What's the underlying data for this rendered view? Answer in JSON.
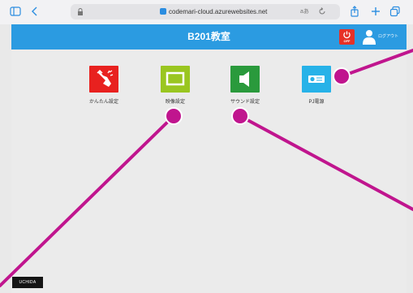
{
  "browser": {
    "url": "codemari-cloud.azurewebsites.net",
    "text_size_label": "aあ"
  },
  "header": {
    "title": "B201教室",
    "power_off_label": "OFF",
    "logout_label": "ログアウト"
  },
  "tiles": [
    {
      "label": "かんたん設定",
      "color": "#e8211f",
      "icon": "hand-tap-icon"
    },
    {
      "label": "映像設定",
      "color": "#9ac620",
      "icon": "screen-icon"
    },
    {
      "label": "サウンド設定",
      "color": "#2a9a3c",
      "icon": "speaker-icon"
    },
    {
      "label": "PJ電源",
      "color": "#27b2e8",
      "icon": "projector-icon"
    }
  ],
  "brand": {
    "logo_text": "UCHIDA"
  },
  "colors": {
    "header_bg": "#2b9be1",
    "annotation": "#c0158e"
  }
}
